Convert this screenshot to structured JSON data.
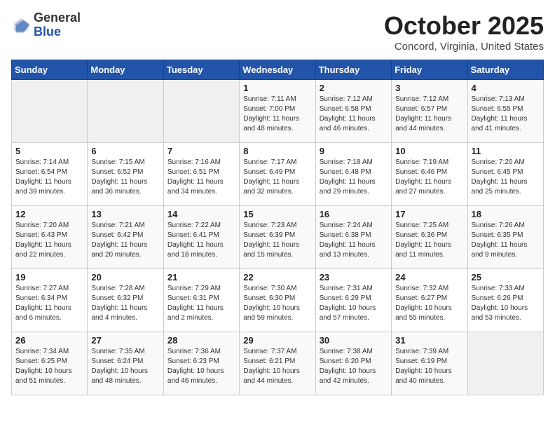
{
  "header": {
    "logo_general": "General",
    "logo_blue": "Blue",
    "month_title": "October 2025",
    "location": "Concord, Virginia, United States"
  },
  "weekdays": [
    "Sunday",
    "Monday",
    "Tuesday",
    "Wednesday",
    "Thursday",
    "Friday",
    "Saturday"
  ],
  "weeks": [
    [
      {
        "day": "",
        "info": ""
      },
      {
        "day": "",
        "info": ""
      },
      {
        "day": "",
        "info": ""
      },
      {
        "day": "1",
        "info": "Sunrise: 7:11 AM\nSunset: 7:00 PM\nDaylight: 11 hours\nand 48 minutes."
      },
      {
        "day": "2",
        "info": "Sunrise: 7:12 AM\nSunset: 6:58 PM\nDaylight: 11 hours\nand 46 minutes."
      },
      {
        "day": "3",
        "info": "Sunrise: 7:12 AM\nSunset: 6:57 PM\nDaylight: 11 hours\nand 44 minutes."
      },
      {
        "day": "4",
        "info": "Sunrise: 7:13 AM\nSunset: 6:55 PM\nDaylight: 11 hours\nand 41 minutes."
      }
    ],
    [
      {
        "day": "5",
        "info": "Sunrise: 7:14 AM\nSunset: 6:54 PM\nDaylight: 11 hours\nand 39 minutes."
      },
      {
        "day": "6",
        "info": "Sunrise: 7:15 AM\nSunset: 6:52 PM\nDaylight: 11 hours\nand 36 minutes."
      },
      {
        "day": "7",
        "info": "Sunrise: 7:16 AM\nSunset: 6:51 PM\nDaylight: 11 hours\nand 34 minutes."
      },
      {
        "day": "8",
        "info": "Sunrise: 7:17 AM\nSunset: 6:49 PM\nDaylight: 11 hours\nand 32 minutes."
      },
      {
        "day": "9",
        "info": "Sunrise: 7:18 AM\nSunset: 6:48 PM\nDaylight: 11 hours\nand 29 minutes."
      },
      {
        "day": "10",
        "info": "Sunrise: 7:19 AM\nSunset: 6:46 PM\nDaylight: 11 hours\nand 27 minutes."
      },
      {
        "day": "11",
        "info": "Sunrise: 7:20 AM\nSunset: 6:45 PM\nDaylight: 11 hours\nand 25 minutes."
      }
    ],
    [
      {
        "day": "12",
        "info": "Sunrise: 7:20 AM\nSunset: 6:43 PM\nDaylight: 11 hours\nand 22 minutes."
      },
      {
        "day": "13",
        "info": "Sunrise: 7:21 AM\nSunset: 6:42 PM\nDaylight: 11 hours\nand 20 minutes."
      },
      {
        "day": "14",
        "info": "Sunrise: 7:22 AM\nSunset: 6:41 PM\nDaylight: 11 hours\nand 18 minutes."
      },
      {
        "day": "15",
        "info": "Sunrise: 7:23 AM\nSunset: 6:39 PM\nDaylight: 11 hours\nand 15 minutes."
      },
      {
        "day": "16",
        "info": "Sunrise: 7:24 AM\nSunset: 6:38 PM\nDaylight: 11 hours\nand 13 minutes."
      },
      {
        "day": "17",
        "info": "Sunrise: 7:25 AM\nSunset: 6:36 PM\nDaylight: 11 hours\nand 11 minutes."
      },
      {
        "day": "18",
        "info": "Sunrise: 7:26 AM\nSunset: 6:35 PM\nDaylight: 11 hours\nand 9 minutes."
      }
    ],
    [
      {
        "day": "19",
        "info": "Sunrise: 7:27 AM\nSunset: 6:34 PM\nDaylight: 11 hours\nand 6 minutes."
      },
      {
        "day": "20",
        "info": "Sunrise: 7:28 AM\nSunset: 6:32 PM\nDaylight: 11 hours\nand 4 minutes."
      },
      {
        "day": "21",
        "info": "Sunrise: 7:29 AM\nSunset: 6:31 PM\nDaylight: 11 hours\nand 2 minutes."
      },
      {
        "day": "22",
        "info": "Sunrise: 7:30 AM\nSunset: 6:30 PM\nDaylight: 10 hours\nand 59 minutes."
      },
      {
        "day": "23",
        "info": "Sunrise: 7:31 AM\nSunset: 6:29 PM\nDaylight: 10 hours\nand 57 minutes."
      },
      {
        "day": "24",
        "info": "Sunrise: 7:32 AM\nSunset: 6:27 PM\nDaylight: 10 hours\nand 55 minutes."
      },
      {
        "day": "25",
        "info": "Sunrise: 7:33 AM\nSunset: 6:26 PM\nDaylight: 10 hours\nand 53 minutes."
      }
    ],
    [
      {
        "day": "26",
        "info": "Sunrise: 7:34 AM\nSunset: 6:25 PM\nDaylight: 10 hours\nand 51 minutes."
      },
      {
        "day": "27",
        "info": "Sunrise: 7:35 AM\nSunset: 6:24 PM\nDaylight: 10 hours\nand 48 minutes."
      },
      {
        "day": "28",
        "info": "Sunrise: 7:36 AM\nSunset: 6:23 PM\nDaylight: 10 hours\nand 46 minutes."
      },
      {
        "day": "29",
        "info": "Sunrise: 7:37 AM\nSunset: 6:21 PM\nDaylight: 10 hours\nand 44 minutes."
      },
      {
        "day": "30",
        "info": "Sunrise: 7:38 AM\nSunset: 6:20 PM\nDaylight: 10 hours\nand 42 minutes."
      },
      {
        "day": "31",
        "info": "Sunrise: 7:39 AM\nSunset: 6:19 PM\nDaylight: 10 hours\nand 40 minutes."
      },
      {
        "day": "",
        "info": ""
      }
    ]
  ]
}
